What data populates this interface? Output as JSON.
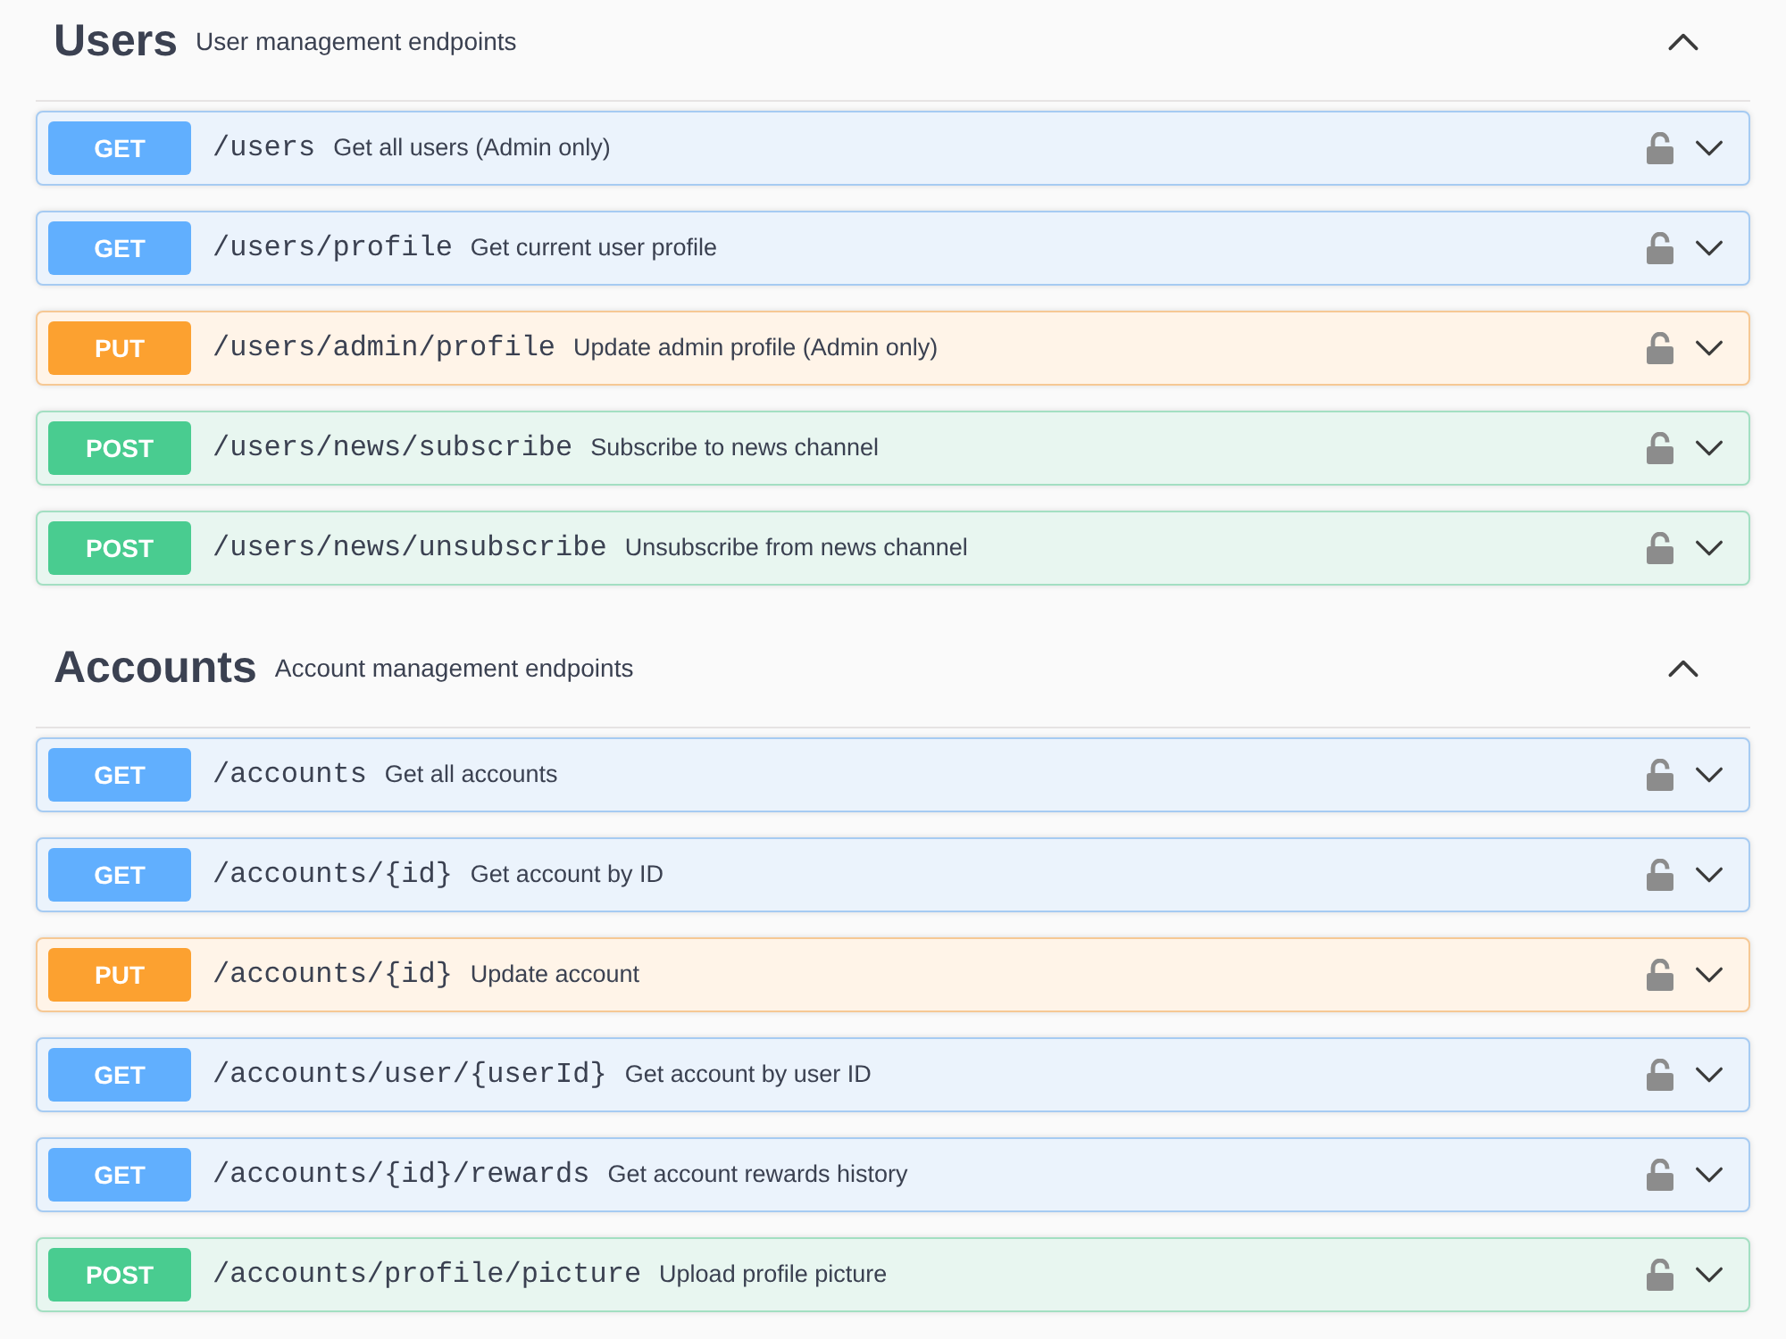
{
  "sections": [
    {
      "name": "Users",
      "description": "User management endpoints",
      "expanded": true,
      "endpoints": [
        {
          "kind": "get",
          "method": "GET",
          "path": "/users",
          "summary": "Get all users (Admin only)",
          "locked": false,
          "expanded": false
        },
        {
          "kind": "get",
          "method": "GET",
          "path": "/users/profile",
          "summary": "Get current user profile",
          "locked": false,
          "expanded": false
        },
        {
          "kind": "put",
          "method": "PUT",
          "path": "/users/admin/profile",
          "summary": "Update admin profile (Admin only)",
          "locked": false,
          "expanded": false
        },
        {
          "kind": "post",
          "method": "POST",
          "path": "/users/news/subscribe",
          "summary": "Subscribe to news channel",
          "locked": false,
          "expanded": false
        },
        {
          "kind": "post",
          "method": "POST",
          "path": "/users/news/unsubscribe",
          "summary": "Unsubscribe from news channel",
          "locked": false,
          "expanded": false
        }
      ]
    },
    {
      "name": "Accounts",
      "description": "Account management endpoints",
      "expanded": true,
      "endpoints": [
        {
          "kind": "get",
          "method": "GET",
          "path": "/accounts",
          "summary": "Get all accounts",
          "locked": false,
          "expanded": false
        },
        {
          "kind": "get",
          "method": "GET",
          "path": "/accounts/{id}",
          "summary": "Get account by ID",
          "locked": false,
          "expanded": false
        },
        {
          "kind": "put",
          "method": "PUT",
          "path": "/accounts/{id}",
          "summary": "Update account",
          "locked": false,
          "expanded": false
        },
        {
          "kind": "get",
          "method": "GET",
          "path": "/accounts/user/{userId}",
          "summary": "Get account by user ID",
          "locked": false,
          "expanded": false
        },
        {
          "kind": "get",
          "method": "GET",
          "path": "/accounts/{id}/rewards",
          "summary": "Get account rewards history",
          "locked": false,
          "expanded": false
        },
        {
          "kind": "post",
          "method": "POST",
          "path": "/accounts/profile/picture",
          "summary": "Upload profile picture",
          "locked": false,
          "expanded": false
        }
      ]
    }
  ]
}
